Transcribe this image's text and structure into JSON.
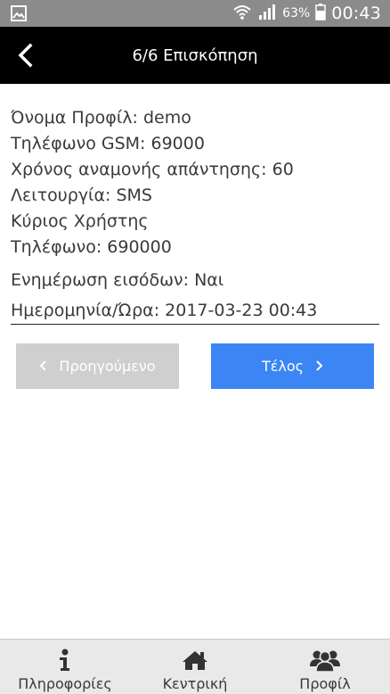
{
  "status_bar": {
    "battery_percent": "63%",
    "time": "00:43",
    "icons": [
      "image-icon",
      "wifi-icon",
      "signal-icon",
      "battery-icon"
    ]
  },
  "header": {
    "title": "6/6 Επισκόπηση",
    "back_icon": "chevron-left-icon"
  },
  "summary": {
    "profile_name": "Όνομα Προφίλ: demo",
    "gsm_phone": "Τηλέφωνο GSM: 69000",
    "response_wait": "Χρόνος αναμονής απάντησης: 60",
    "mode": "Λειτουργία: SMS",
    "main_user": "Κύριος Χρήστης",
    "phone": "Τηλέφωνο: 690000",
    "input_update": "Ενημέρωση εισόδων: Ναι",
    "datetime": "Ημερομηνία/Ώρα: 2017-03-23 00:43"
  },
  "buttons": {
    "prev_label": "Προηγούμενο",
    "next_label": "Τέλος",
    "prev_color": "#cfcfcf",
    "next_color": "#3b86f4"
  },
  "bottom_nav": {
    "items": [
      {
        "label": "Πληροφορίες",
        "icon": "info-icon"
      },
      {
        "label": "Κεντρική",
        "icon": "home-icon"
      },
      {
        "label": "Προφίλ",
        "icon": "users-icon"
      }
    ]
  }
}
